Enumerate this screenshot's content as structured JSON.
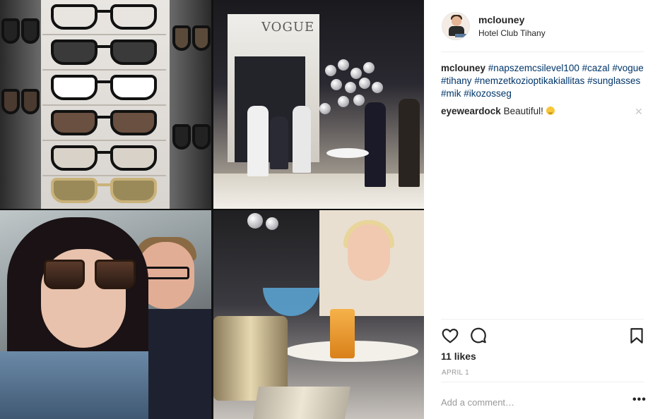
{
  "post": {
    "username": "mclouney",
    "location": "Hotel Club Tihany",
    "caption_user": "mclouney",
    "hashtags": [
      "#napszemcsilevel100",
      "#cazal",
      "#vogue",
      "#tihany",
      "#nemzetkozioptikakiallitas",
      "#sunglasses",
      "#mik",
      "#ikozosseg"
    ],
    "comment": {
      "user": "eyeweardock",
      "text": "Beautiful!"
    },
    "likes": "11 likes",
    "date": "APRIL 1",
    "add_comment_placeholder": "Add a comment…",
    "photo_brand_text": "VOGUE"
  },
  "icons": {
    "like": "heart-icon",
    "comment": "comment-bubble-icon",
    "save": "bookmark-icon",
    "more": "more-dots-icon",
    "close": "close-icon"
  }
}
